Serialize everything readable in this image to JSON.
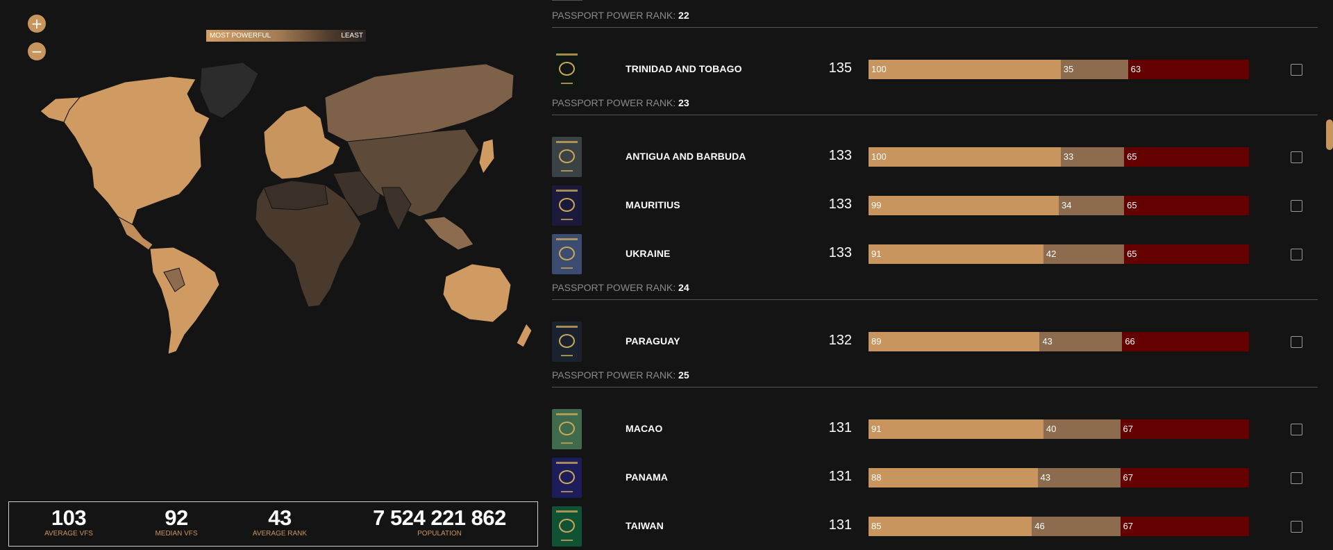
{
  "map": {
    "zoom_in_label": "+",
    "zoom_out_label": "−",
    "legend": {
      "left_label": "MOST POWERFUL",
      "right_label": "LEAST"
    }
  },
  "stats": {
    "average_vfs": {
      "value": "103",
      "label": "AVERAGE VFS"
    },
    "median_vfs": {
      "value": "92",
      "label": "MEDIAN VFS"
    },
    "average_rank": {
      "value": "43",
      "label": "AVERAGE RANK"
    },
    "population": {
      "value": "7 524 221 862",
      "label": "POPULATION"
    }
  },
  "list": {
    "rank_prefix": "PASSPORT POWER RANK:",
    "groups": [
      {
        "rank": "22",
        "countries": [
          {
            "name": "TRINIDAD AND TOBAGO",
            "total": "135",
            "free": "100",
            "on_arrival": "35",
            "required": "63",
            "cover": "#101612"
          }
        ]
      },
      {
        "rank": "23",
        "countries": [
          {
            "name": "ANTIGUA AND BARBUDA",
            "total": "133",
            "free": "100",
            "on_arrival": "33",
            "required": "65",
            "cover": "#3a4246"
          },
          {
            "name": "MAURITIUS",
            "total": "133",
            "free": "99",
            "on_arrival": "34",
            "required": "65",
            "cover": "#1c1a3a"
          },
          {
            "name": "UKRAINE",
            "total": "133",
            "free": "91",
            "on_arrival": "42",
            "required": "65",
            "cover": "#3b4c70"
          }
        ]
      },
      {
        "rank": "24",
        "countries": [
          {
            "name": "PARAGUAY",
            "total": "132",
            "free": "89",
            "on_arrival": "43",
            "required": "66",
            "cover": "#1a2230"
          }
        ]
      },
      {
        "rank": "25",
        "countries": [
          {
            "name": "MACAO",
            "total": "131",
            "free": "91",
            "on_arrival": "40",
            "required": "67",
            "cover": "#3f6a4c"
          },
          {
            "name": "PANAMA",
            "total": "131",
            "free": "88",
            "on_arrival": "43",
            "required": "67",
            "cover": "#1e1d5c"
          },
          {
            "name": "TAIWAN",
            "total": "131",
            "free": "85",
            "on_arrival": "46",
            "required": "67",
            "cover": "#0f5234"
          }
        ]
      }
    ]
  },
  "colors": {
    "free": "#c8955e",
    "on_arrival": "#8c6b4e",
    "required": "#650000",
    "accent": "#c8955e"
  }
}
